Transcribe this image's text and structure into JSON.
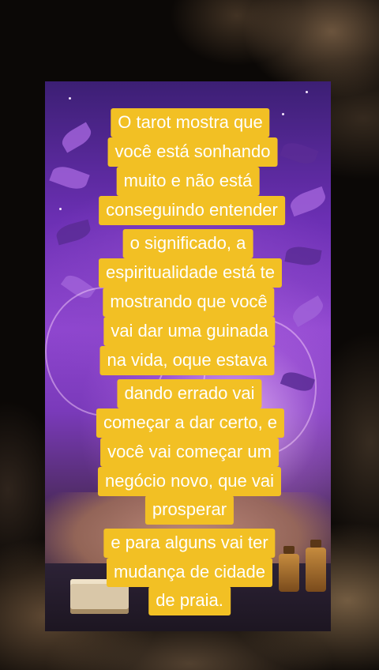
{
  "caption": {
    "lines": [
      "O tarot mostra que",
      "você está sonhando",
      "muito e não está",
      "conseguindo entender",
      "o significado, a",
      "espiritualidade está te",
      "mostrando que você",
      "vai dar uma guinada",
      "na vida, oque estava",
      "dando errado vai",
      "começar a dar certo, e",
      "você vai começar um",
      "negócio novo, que vai",
      "prosperar",
      "e para alguns vai ter",
      "mudança de cidade",
      "de praia."
    ],
    "highlight_color": "#f2c024",
    "text_color": "#ffffff"
  },
  "background": {
    "card_colors": [
      "#3c1f74",
      "#8f46cf",
      "#3a2c2e"
    ],
    "smoke_color": "#8c6e50"
  }
}
